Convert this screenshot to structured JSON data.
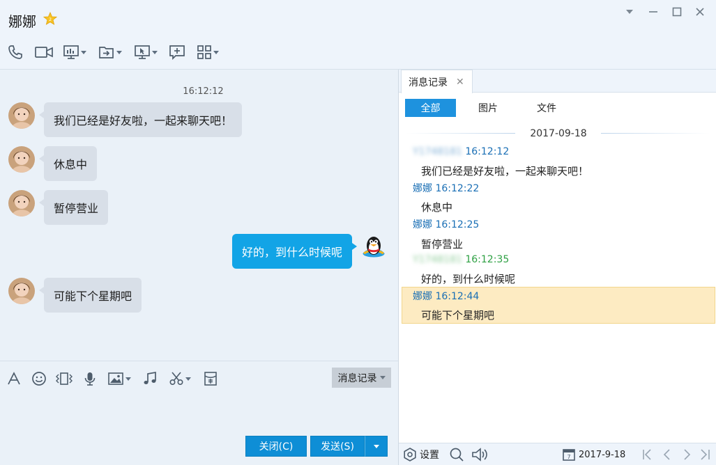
{
  "header": {
    "contact_name": "娜娜",
    "window_controls": [
      "chevron-down-icon",
      "minimize-icon",
      "maximize-icon",
      "close-icon"
    ],
    "toolbar": [
      "phone-icon",
      "video-camera-icon",
      "screen-share-icon",
      "file-transfer-icon",
      "remote-desktop-icon",
      "add-comment-icon",
      "app-grid-icon"
    ]
  },
  "chat": {
    "timestamp": "16:12:12",
    "messages": [
      {
        "direction": "in",
        "text": "我们已经是好友啦，一起来聊天吧！"
      },
      {
        "direction": "in",
        "text": "休息中"
      },
      {
        "direction": "in",
        "text": "暂停营业"
      },
      {
        "direction": "out",
        "text": "好的，到什么时候呢"
      },
      {
        "direction": "in",
        "text": "可能下个星期吧"
      }
    ]
  },
  "input_toolbar": {
    "icons": [
      "font-icon",
      "emoji-icon",
      "shake-icon",
      "microphone-icon",
      "image-icon",
      "music-icon",
      "scissors-icon",
      "red-envelope-icon"
    ],
    "history_button": "消息记录"
  },
  "buttons": {
    "close": "关闭(C)",
    "send": "发送(S)"
  },
  "history": {
    "tab_label": "消息记录",
    "filters": {
      "all": "全部",
      "images": "图片",
      "files": "文件"
    },
    "date": "2017-09-18",
    "entries": [
      {
        "sender": "Y1748181",
        "time": "16:12:12",
        "direction": "out",
        "text": "我们已经是好友啦，一起来聊天吧！"
      },
      {
        "sender": "娜娜",
        "time": "16:12:22",
        "direction": "in",
        "text": "休息中"
      },
      {
        "sender": "娜娜",
        "time": "16:12:25",
        "direction": "in",
        "text": "暂停营业"
      },
      {
        "sender": "Y1748181",
        "time": "16:12:35",
        "direction": "out",
        "text": "好的，到什么时候呢"
      },
      {
        "sender": "娜娜",
        "time": "16:12:44",
        "direction": "in",
        "text": "可能下个星期吧"
      }
    ],
    "footer": {
      "settings_label": "设置",
      "date": "2017-9-18"
    }
  },
  "colors": {
    "accent": "#12a4e6",
    "button": "#0e8ed6",
    "highlight": "#fdebc2",
    "incoming_name": "#1a6fb5",
    "outgoing_name": "#2ea043"
  }
}
